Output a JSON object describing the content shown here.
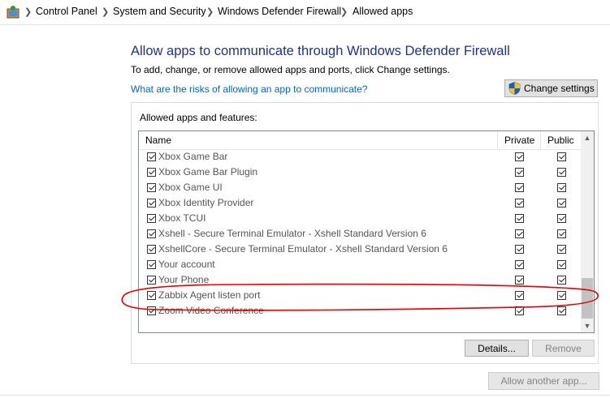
{
  "breadcrumb": {
    "items": [
      "Control Panel",
      "System and Security",
      "Windows Defender Firewall",
      "Allowed apps"
    ]
  },
  "page": {
    "heading": "Allow apps to communicate through Windows Defender Firewall",
    "subtext": "To add, change, or remove allowed apps and ports, click Change settings.",
    "risk_link": "What are the risks of allowing an app to communicate?",
    "change_settings": "Change settings"
  },
  "group": {
    "label": "Allowed apps and features:",
    "columns": {
      "name": "Name",
      "private": "Private",
      "public": "Public"
    },
    "rows": [
      {
        "name": "Xbox Game Bar",
        "checked": true,
        "private": true,
        "public": true
      },
      {
        "name": "Xbox Game Bar Plugin",
        "checked": true,
        "private": true,
        "public": true
      },
      {
        "name": "Xbox Game UI",
        "checked": true,
        "private": true,
        "public": true
      },
      {
        "name": "Xbox Identity Provider",
        "checked": true,
        "private": true,
        "public": true
      },
      {
        "name": "Xbox TCUI",
        "checked": true,
        "private": true,
        "public": true
      },
      {
        "name": "Xshell - Secure Terminal Emulator - Xshell Standard Version 6",
        "checked": true,
        "private": true,
        "public": true
      },
      {
        "name": "XshellCore - Secure Terminal Emulator - Xshell Standard Version 6",
        "checked": true,
        "private": true,
        "public": true
      },
      {
        "name": "Your account",
        "checked": true,
        "private": true,
        "public": true
      },
      {
        "name": "Your Phone",
        "checked": true,
        "private": true,
        "public": true
      },
      {
        "name": "Zabbix Agent listen port",
        "checked": true,
        "private": true,
        "public": true
      },
      {
        "name": "Zoom Video Conference",
        "checked": true,
        "private": true,
        "public": true
      }
    ],
    "details": "Details...",
    "remove": "Remove"
  },
  "allow_another": "Allow another app...",
  "colors": {
    "heading": "#1e3287",
    "link": "#0066cc",
    "annotation": "#e00000"
  }
}
